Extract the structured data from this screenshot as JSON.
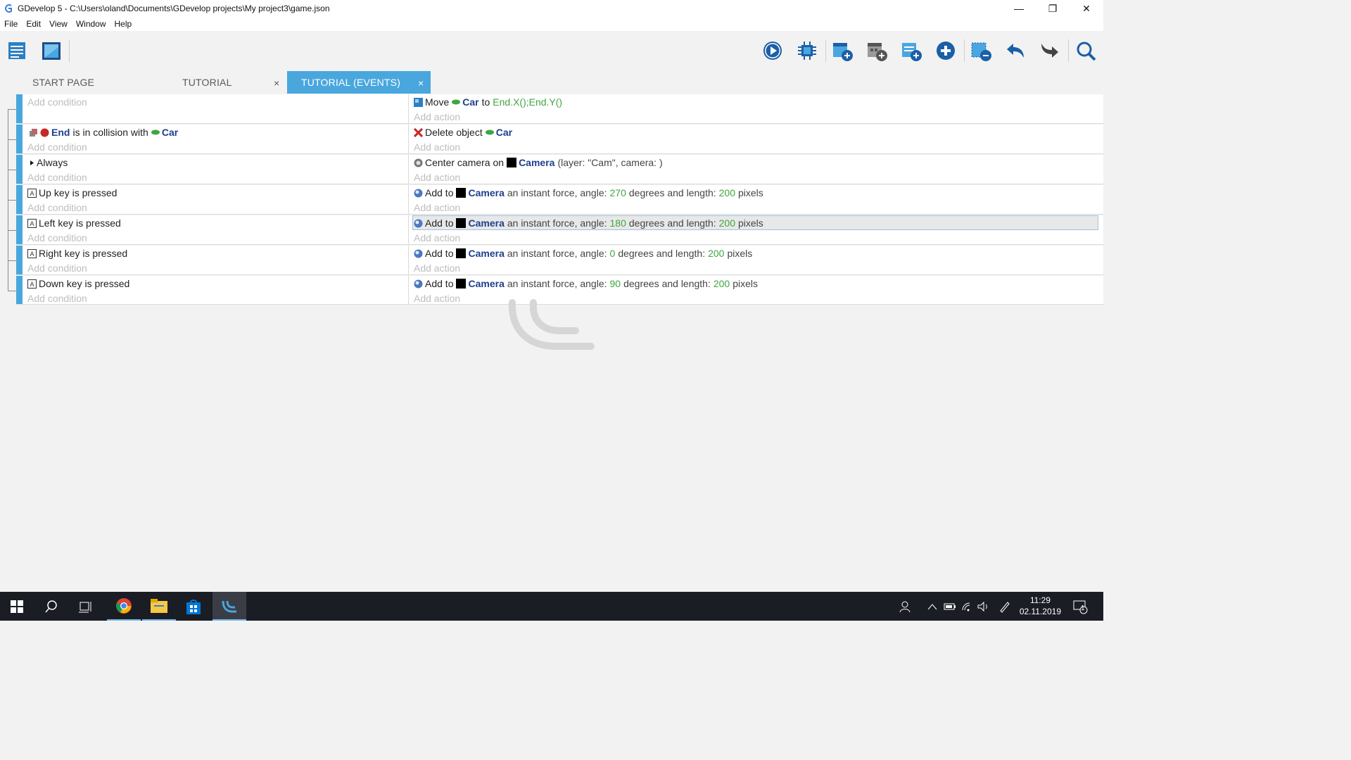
{
  "window": {
    "title": "GDevelop 5 - C:\\Users\\oland\\Documents\\GDevelop projects\\My project3\\game.json",
    "minimize": "—",
    "maximize": "❐",
    "close": "✕"
  },
  "menu": [
    "File",
    "Edit",
    "View",
    "Window",
    "Help"
  ],
  "toolbar": {
    "left_icons": [
      "project-manager-icon",
      "scene-editor-icon"
    ],
    "right_icons": [
      "preview-icon",
      "debug-icon",
      "add-event-icon",
      "add-sub-event-icon",
      "add-comment-icon",
      "add-other-icon",
      "delete-icon",
      "undo-icon",
      "redo-icon",
      "search-icon"
    ]
  },
  "tabs": [
    {
      "label": "START PAGE"
    },
    {
      "label": "TUTORIAL"
    },
    {
      "label": "TUTORIAL (EVENTS)"
    }
  ],
  "tab_close": "×",
  "events": {
    "add_condition": "Add condition",
    "add_action": "Add action",
    "rows": [
      {
        "action": {
          "verb": "Move",
          "object": "Car",
          "mid": "to",
          "expr": "End.X();End.Y()"
        }
      },
      {
        "condition": {
          "object1": "End",
          "text": "is in collision with",
          "object2": "Car"
        },
        "action": {
          "verb": "Delete object",
          "object": "Car"
        }
      },
      {
        "condition": {
          "text": "Always"
        },
        "action": {
          "verb": "Center camera on",
          "object": "Camera",
          "rest": "(layer: \"Cam\", camera: )"
        }
      },
      {
        "condition": {
          "key": "Up",
          "text": "key is pressed"
        },
        "action": {
          "verb": "Add to",
          "object": "Camera",
          "mid": "an instant force, angle:",
          "angle": "270",
          "mid2": "degrees and length:",
          "length": "200",
          "end": "pixels"
        }
      },
      {
        "condition": {
          "key": "Left",
          "text": "key is pressed"
        },
        "action": {
          "verb": "Add to",
          "object": "Camera",
          "mid": "an instant force, angle:",
          "angle": "180",
          "mid2": "degrees and length:",
          "length": "200",
          "end": "pixels"
        }
      },
      {
        "condition": {
          "key": "Right",
          "text": "key is pressed"
        },
        "action": {
          "verb": "Add to",
          "object": "Camera",
          "mid": "an instant force, angle:",
          "angle": "0",
          "mid2": "degrees and length:",
          "length": "200",
          "end": "pixels"
        }
      },
      {
        "condition": {
          "key": "Down",
          "text": "key is pressed"
        },
        "action": {
          "verb": "Add to",
          "object": "Camera",
          "mid": "an instant force, angle:",
          "angle": "90",
          "mid2": "degrees and length:",
          "length": "200",
          "end": "pixels"
        }
      }
    ]
  },
  "colors": {
    "accent": "#49a7de",
    "object": "#1d3f8c",
    "number": "#3fa63f"
  },
  "taskbar": {
    "time": "11:29",
    "date": "02.11.2019",
    "notification_count": "1"
  }
}
